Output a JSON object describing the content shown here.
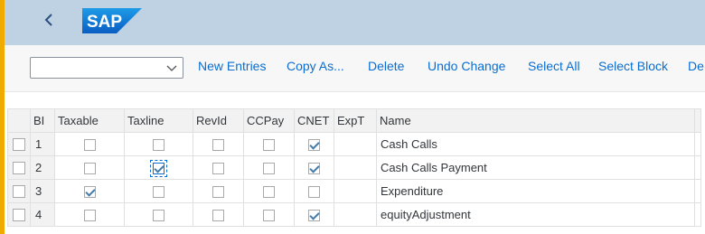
{
  "shell": {
    "back_icon": "chevron-left-icon",
    "logo_text": "SAP",
    "brand_color": "#0a6ed1"
  },
  "toolbar": {
    "combo_value": "",
    "buttons": [
      "New Entries",
      "Copy As...",
      "Delete",
      "Undo Change",
      "Select All",
      "Select Block",
      "De"
    ]
  },
  "table": {
    "headers": [
      "BI",
      "Taxable",
      "Taxline",
      "RevId",
      "CCPay",
      "CNET",
      "ExpT",
      "Name"
    ],
    "rows": [
      {
        "bi": "1",
        "taxable": false,
        "taxline": false,
        "revid": false,
        "ccpay": false,
        "cnet": true,
        "name": "Cash Calls"
      },
      {
        "bi": "2",
        "taxable": false,
        "taxline": true,
        "revid": false,
        "ccpay": false,
        "cnet": true,
        "name": "Cash Calls Payment"
      },
      {
        "bi": "3",
        "taxable": true,
        "taxline": false,
        "revid": false,
        "ccpay": false,
        "cnet": false,
        "name": "Expenditure"
      },
      {
        "bi": "4",
        "taxable": false,
        "taxline": false,
        "revid": false,
        "ccpay": false,
        "cnet": true,
        "name": "equityAdjustment"
      }
    ]
  }
}
